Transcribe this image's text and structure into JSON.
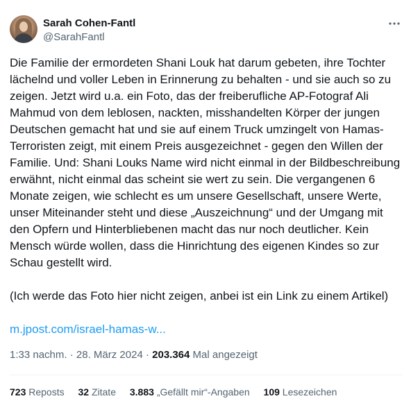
{
  "author": {
    "display_name": "Sarah Cohen-Fantl",
    "handle": "@SarahFantl"
  },
  "more_icon": "more-horizontal-icon",
  "body": {
    "paragraph1": "Die Familie der ermordeten Shani Louk hat darum gebeten, ihre Tochter lächelnd und voller Leben in Erinnerung zu behalten - und sie auch so zu zeigen. Jetzt wird u.a. ein Foto, das der  freiberufliche AP-Fotograf Ali Mahmud von dem leblosen, nackten, misshandelten Körper der jungen Deutschen gemacht hat und sie auf einem Truck umzingelt von Hamas-Terroristen zeigt, mit einem Preis ausgezeichnet - gegen den Willen der Familie. Und: Shani Louks Name wird nicht einmal in der Bildbeschreibung erwähnt, nicht einmal das scheint sie wert zu sein. Die vergangenen 6 Monate zeigen, wie schlecht es um unsere Gesellschaft, unsere Werte, unser Miteinander steht und diese „Auszeichnung“ und der Umgang mit den Opfern und Hinterbliebenen macht das nur noch deutlicher. Kein Mensch würde wollen, dass die Hinrichtung des eigenen Kindes so zur Schau gestellt wird.",
    "paragraph2": "(Ich werde das Foto hier nicht zeigen, anbei ist ein Link zu einem Artikel)",
    "link_text": "m.jpost.com/israel-hamas-w..."
  },
  "meta": {
    "time": "1:33 nachm.",
    "separator": "·",
    "date": "28. März 2024",
    "views_count": "203.364",
    "views_label": "Mal angezeigt"
  },
  "stats": {
    "reposts_count": "723",
    "reposts_label": "Reposts",
    "quotes_count": "32",
    "quotes_label": "Zitate",
    "likes_count": "3.883",
    "likes_label": "„Gefällt mir“-Angaben",
    "bookmarks_count": "109",
    "bookmarks_label": "Lesezeichen"
  },
  "colors": {
    "text": "#0f1419",
    "secondary": "#536471",
    "link": "#1d9bf0",
    "divider": "#eff3f4"
  }
}
